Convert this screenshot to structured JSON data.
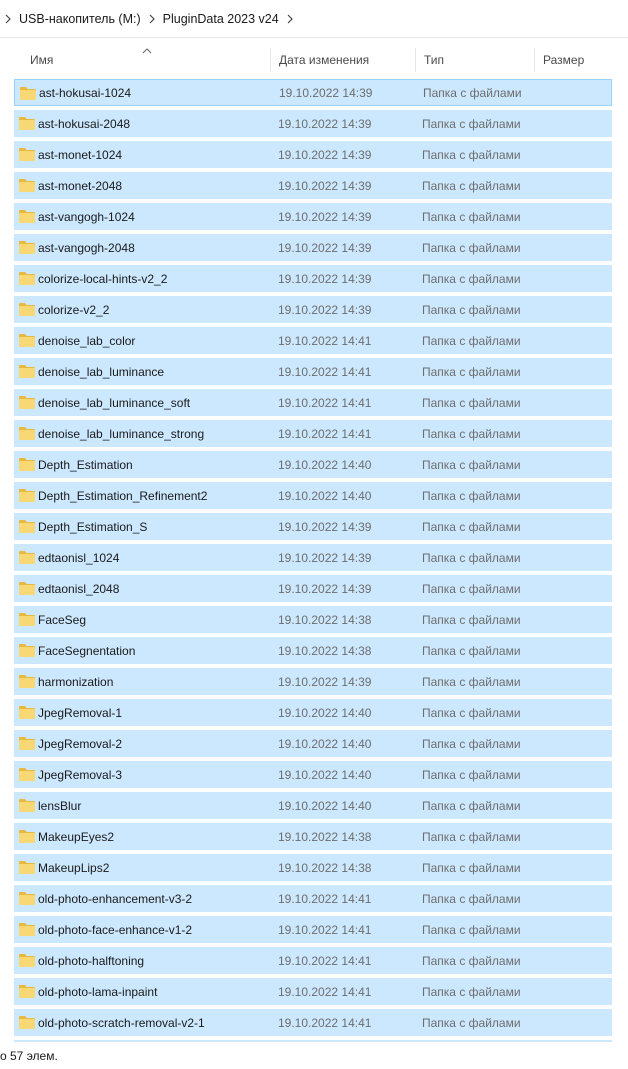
{
  "breadcrumb": {
    "items": [
      "USB-накопитель (M:)",
      "PluginData 2023 v24"
    ]
  },
  "columns": {
    "name": "Имя",
    "date": "Дата изменения",
    "type": "Тип",
    "size": "Размер"
  },
  "colors": {
    "selection": "#cce8ff",
    "selection_border": "#99d1ff",
    "folder": "#f8d775",
    "folder_dark": "#e8b93c"
  },
  "icons": {
    "folder": "folder-icon",
    "chevron": "chevron-right-icon",
    "sort": "sort-up-icon"
  },
  "rows": [
    {
      "name": "ast-hokusai-1024",
      "date": "19.10.2022 14:39",
      "type": "Папка с файлами"
    },
    {
      "name": "ast-hokusai-2048",
      "date": "19.10.2022 14:39",
      "type": "Папка с файлами"
    },
    {
      "name": "ast-monet-1024",
      "date": "19.10.2022 14:39",
      "type": "Папка с файлами"
    },
    {
      "name": "ast-monet-2048",
      "date": "19.10.2022 14:39",
      "type": "Папка с файлами"
    },
    {
      "name": "ast-vangogh-1024",
      "date": "19.10.2022 14:39",
      "type": "Папка с файлами"
    },
    {
      "name": "ast-vangogh-2048",
      "date": "19.10.2022 14:39",
      "type": "Папка с файлами"
    },
    {
      "name": "colorize-local-hints-v2_2",
      "date": "19.10.2022 14:39",
      "type": "Папка с файлами"
    },
    {
      "name": "colorize-v2_2",
      "date": "19.10.2022 14:39",
      "type": "Папка с файлами"
    },
    {
      "name": "denoise_lab_color",
      "date": "19.10.2022 14:41",
      "type": "Папка с файлами"
    },
    {
      "name": "denoise_lab_luminance",
      "date": "19.10.2022 14:41",
      "type": "Папка с файлами"
    },
    {
      "name": "denoise_lab_luminance_soft",
      "date": "19.10.2022 14:41",
      "type": "Папка с файлами"
    },
    {
      "name": "denoise_lab_luminance_strong",
      "date": "19.10.2022 14:41",
      "type": "Папка с файлами"
    },
    {
      "name": "Depth_Estimation",
      "date": "19.10.2022 14:40",
      "type": "Папка с файлами"
    },
    {
      "name": "Depth_Estimation_Refinement2",
      "date": "19.10.2022 14:40",
      "type": "Папка с файлами"
    },
    {
      "name": "Depth_Estimation_S",
      "date": "19.10.2022 14:39",
      "type": "Папка с файлами"
    },
    {
      "name": "edtaonisl_1024",
      "date": "19.10.2022 14:39",
      "type": "Папка с файлами"
    },
    {
      "name": "edtaonisl_2048",
      "date": "19.10.2022 14:39",
      "type": "Папка с файлами"
    },
    {
      "name": "FaceSeg",
      "date": "19.10.2022 14:38",
      "type": "Папка с файлами"
    },
    {
      "name": "FaceSegnentation",
      "date": "19.10.2022 14:38",
      "type": "Папка с файлами"
    },
    {
      "name": "harmonization",
      "date": "19.10.2022 14:39",
      "type": "Папка с файлами"
    },
    {
      "name": "JpegRemoval-1",
      "date": "19.10.2022 14:40",
      "type": "Папка с файлами"
    },
    {
      "name": "JpegRemoval-2",
      "date": "19.10.2022 14:40",
      "type": "Папка с файлами"
    },
    {
      "name": "JpegRemoval-3",
      "date": "19.10.2022 14:40",
      "type": "Папка с файлами"
    },
    {
      "name": "lensBlur",
      "date": "19.10.2022 14:40",
      "type": "Папка с файлами"
    },
    {
      "name": "MakeupEyes2",
      "date": "19.10.2022 14:38",
      "type": "Папка с файлами"
    },
    {
      "name": "MakeupLips2",
      "date": "19.10.2022 14:38",
      "type": "Папка с файлами"
    },
    {
      "name": "old-photo-enhancement-v3-2",
      "date": "19.10.2022 14:41",
      "type": "Папка с файлами"
    },
    {
      "name": "old-photo-face-enhance-v1-2",
      "date": "19.10.2022 14:41",
      "type": "Папка с файлами"
    },
    {
      "name": "old-photo-halftoning",
      "date": "19.10.2022 14:41",
      "type": "Папка с файлами"
    },
    {
      "name": "old-photo-lama-inpaint",
      "date": "19.10.2022 14:41",
      "type": "Папка с файлами"
    },
    {
      "name": "old-photo-scratch-removal-v2-1",
      "date": "19.10.2022 14:41",
      "type": "Папка с файлами"
    }
  ],
  "status": {
    "text": "о 57 элем."
  }
}
